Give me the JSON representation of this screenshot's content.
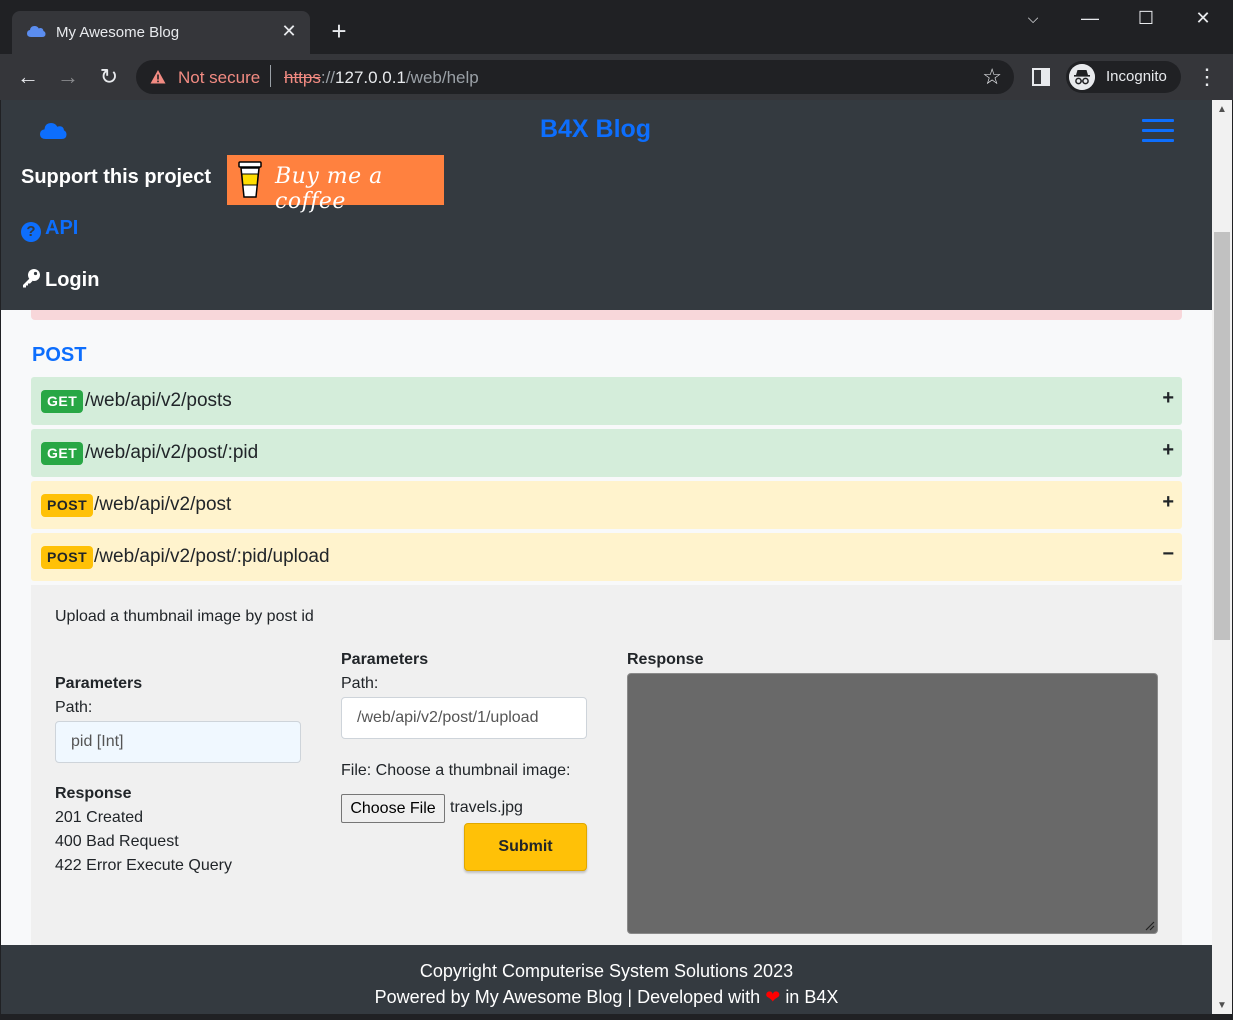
{
  "browser": {
    "tab_title": "My Awesome Blog",
    "new_tab": "+",
    "security_label": "Not secure",
    "url_scheme": "https",
    "url_sep": "://",
    "url_host": "127.0.0.1",
    "url_path": "/web/help",
    "profile_label": "Incognito"
  },
  "header": {
    "brand": "B4X Blog",
    "support_label": "Support this project",
    "coffee_label": "Buy me a coffee",
    "api_label": "API",
    "login_label": "Login"
  },
  "section": {
    "title": "POST"
  },
  "endpoints": [
    {
      "method": "GET",
      "path": "/web/api/v2/posts",
      "toggle": "+"
    },
    {
      "method": "GET",
      "path": "/web/api/v2/post/:pid",
      "toggle": "+"
    },
    {
      "method": "POST",
      "path": "/web/api/v2/post",
      "toggle": "+"
    },
    {
      "method": "POST",
      "path": "/web/api/v2/post/:pid/upload",
      "toggle": "−"
    }
  ],
  "detail": {
    "description": "Upload a thumbnail image by post id",
    "params_title": "Parameters",
    "path_label": "Path:",
    "pid_value": "pid [Int]",
    "response_title": "Response",
    "responses": [
      "201 Created",
      "400 Bad Request",
      "422 Error Execute Query"
    ],
    "form_params_title": "Parameters",
    "form_path_label": "Path:",
    "form_path_value": "/web/api/v2/post/1/upload",
    "file_label": "File: Choose a thumbnail image:",
    "file_button": "Choose File",
    "file_name": "travels.jpg",
    "submit_label": "Submit",
    "output_title": "Response"
  },
  "footer": {
    "line1": "Copyright Computerise System Solutions 2023",
    "line2_prefix": "Powered by My Awesome Blog | Developed with",
    "line2_suffix": "in B4X"
  },
  "colors": {
    "accent": "#0d6efd",
    "header_bg": "#343a40",
    "get_bg": "#d4edda",
    "post_bg": "#fff3cd",
    "coffee": "#ff813f"
  }
}
